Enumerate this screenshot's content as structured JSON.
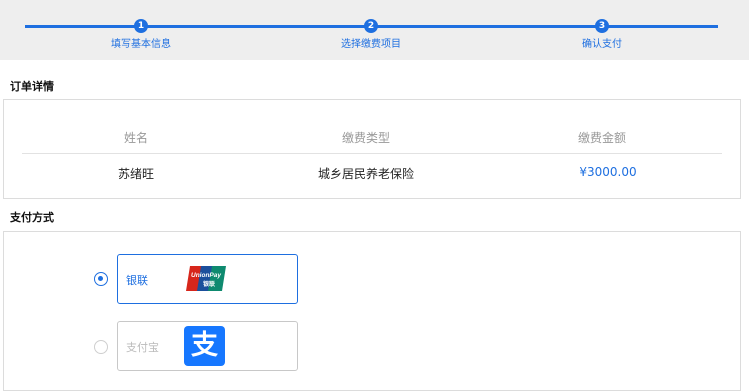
{
  "steps": [
    {
      "number": "1",
      "label": "填写基本信息"
    },
    {
      "number": "2",
      "label": "选择缴费项目"
    },
    {
      "number": "3",
      "label": "确认支付"
    }
  ],
  "order": {
    "title": "订单详情",
    "columns": [
      "姓名",
      "缴费类型",
      "缴费金额"
    ],
    "row": {
      "name": "苏绪旺",
      "type": "城乡居民养老保险",
      "amount": "¥3000.00"
    }
  },
  "payment": {
    "title": "支付方式",
    "options": [
      {
        "label": "银联",
        "logo_text": "UnionPay",
        "logo_sub": "银联",
        "selected": true
      },
      {
        "label": "支付宝",
        "logo_text": "支",
        "selected": false
      }
    ]
  },
  "colors": {
    "accent": "#1e6fe0",
    "unionpay_red": "#d7261b",
    "unionpay_blue": "#1b4f9c",
    "unionpay_green": "#0e8a6f",
    "alipay_blue": "#1677ff"
  }
}
